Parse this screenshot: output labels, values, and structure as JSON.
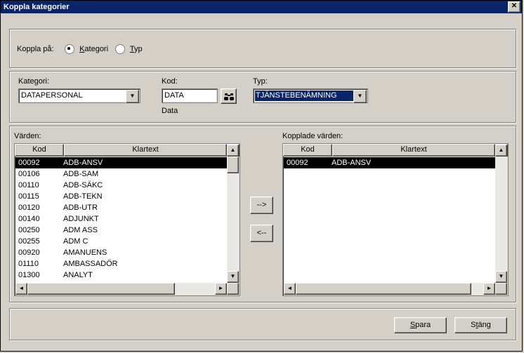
{
  "title": "Koppla kategorier",
  "top": {
    "label": "Koppla på:",
    "radio_kategori": "Kategori",
    "radio_typ": "Typ",
    "kategori_hotkey": "K",
    "typ_hotkey": "T"
  },
  "mid": {
    "kategori_label": "Kategori:",
    "kategori_value": "DATAPERSONAL",
    "kod_label": "Kod:",
    "kod_value": "DATA",
    "kod_echo": "Data",
    "typ_label": "Typ:",
    "typ_value": "TJÄNSTEBENÄMNING"
  },
  "lists": {
    "left_label": "Värden:",
    "right_label": "Kopplade värden:",
    "col_kod": "Kod",
    "col_klartext": "Klartext",
    "add_label": "-->",
    "remove_label": "<--",
    "left_rows": [
      {
        "kod": "00092",
        "txt": "ADB-ANSV",
        "sel": true
      },
      {
        "kod": "00106",
        "txt": "ADB-SAM"
      },
      {
        "kod": "00110",
        "txt": "ADB-SÄKC"
      },
      {
        "kod": "00115",
        "txt": "ADB-TEKN"
      },
      {
        "kod": "00120",
        "txt": "ADB-UTR"
      },
      {
        "kod": "00140",
        "txt": "ADJUNKT"
      },
      {
        "kod": "00250",
        "txt": "ADM ASS"
      },
      {
        "kod": "00255",
        "txt": "ADM C"
      },
      {
        "kod": "00920",
        "txt": "AMANUENS"
      },
      {
        "kod": "01110",
        "txt": "AMBASSADÖR"
      },
      {
        "kod": "01300",
        "txt": "ANALYT"
      }
    ],
    "right_rows": [
      {
        "kod": "00092",
        "txt": "ADB-ANSV",
        "sel": true
      }
    ]
  },
  "buttons": {
    "save": "Spara",
    "close": "Stäng",
    "save_hotkey": "S",
    "close_hotkey": "t"
  }
}
